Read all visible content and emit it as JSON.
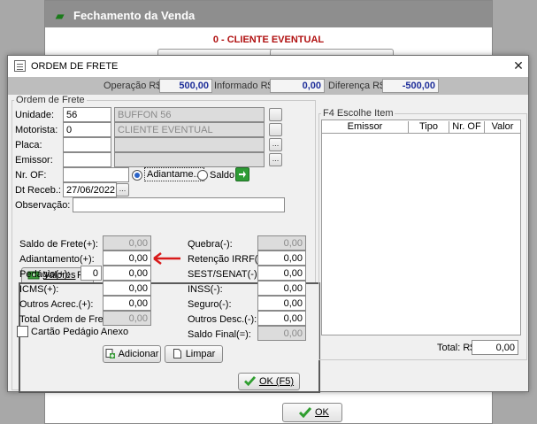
{
  "background": {
    "title": "Fechamento da Venda",
    "subtitle": "0 - CLIENTE EVENTUAL",
    "ok_label": "OK"
  },
  "dialog": {
    "title": "ORDEM DE FRETE",
    "close_label": "✕",
    "header": {
      "operacao_label": "Operação R$",
      "operacao_value": "500,00",
      "informado_label": "Informado R$",
      "informado_value": "0,00",
      "diferenca_label": "Diferença R$",
      "diferenca_value": "-500,00"
    },
    "ordem": {
      "group_label": "Ordem de Frete",
      "unidade_label": "Unidade:",
      "unidade_code": "56",
      "unidade_name": "BUFFON 56",
      "motorista_label": "Motorista:",
      "motorista_code": "0",
      "motorista_name": "CLIENTE EVENTUAL",
      "placa_label": "Placa:",
      "emissor_label": "Emissor:",
      "nr_of_label": "Nr. OF:",
      "adiantamento_option": "Adiantame...",
      "saldo_option": "Saldo",
      "dt_receb_label": "Dt Receb.:",
      "dt_receb_value": "27/06/2022",
      "observacao_label": "Observação:"
    },
    "valores": {
      "tab_label": "Valores",
      "tab_shortcut": "F3",
      "left": [
        {
          "label": "Saldo de Frete(+):",
          "value": "0,00",
          "disabled": true
        },
        {
          "label": "Adiantamento(+):",
          "value": "0,00",
          "disabled": false
        },
        {
          "label": "Pedágio(+):",
          "qty": "0",
          "value": "0,00",
          "disabled": false
        },
        {
          "label": "ICMS(+):",
          "value": "0,00",
          "disabled": false
        },
        {
          "label": "Outros Acrec.(+):",
          "value": "0,00",
          "disabled": false
        },
        {
          "label": "Total Ordem de Fret...",
          "value": "0,00",
          "disabled": true
        }
      ],
      "cartao_label": "Cartão Pedágio Anexo",
      "right": [
        {
          "label": "Quebra(-):",
          "value": "0,00",
          "disabled": true
        },
        {
          "label": "Retenção IRRF(-):",
          "value": "0,00",
          "disabled": false
        },
        {
          "label": "SEST/SENAT(-):",
          "value": "0,00",
          "disabled": false
        },
        {
          "label": "INSS(-):",
          "value": "0,00",
          "disabled": false
        },
        {
          "label": "Seguro(-):",
          "value": "0,00",
          "disabled": false
        },
        {
          "label": "Outros Desc.(-):",
          "value": "0,00",
          "disabled": false
        },
        {
          "label": "Saldo Final(=):",
          "value": "0,00",
          "disabled": true
        }
      ],
      "arrow_color": "#d81a1a"
    },
    "escolhe": {
      "group_label": "F4 Escolhe Item",
      "columns": [
        "Emissor",
        "Tipo",
        "Nr. OF",
        "Valor"
      ],
      "total_label": "Total: R$",
      "total_value": "0,00"
    },
    "buttons": {
      "adicionar": "Adicionar",
      "limpar": "Limpar",
      "ok": "OK (F5)"
    }
  }
}
